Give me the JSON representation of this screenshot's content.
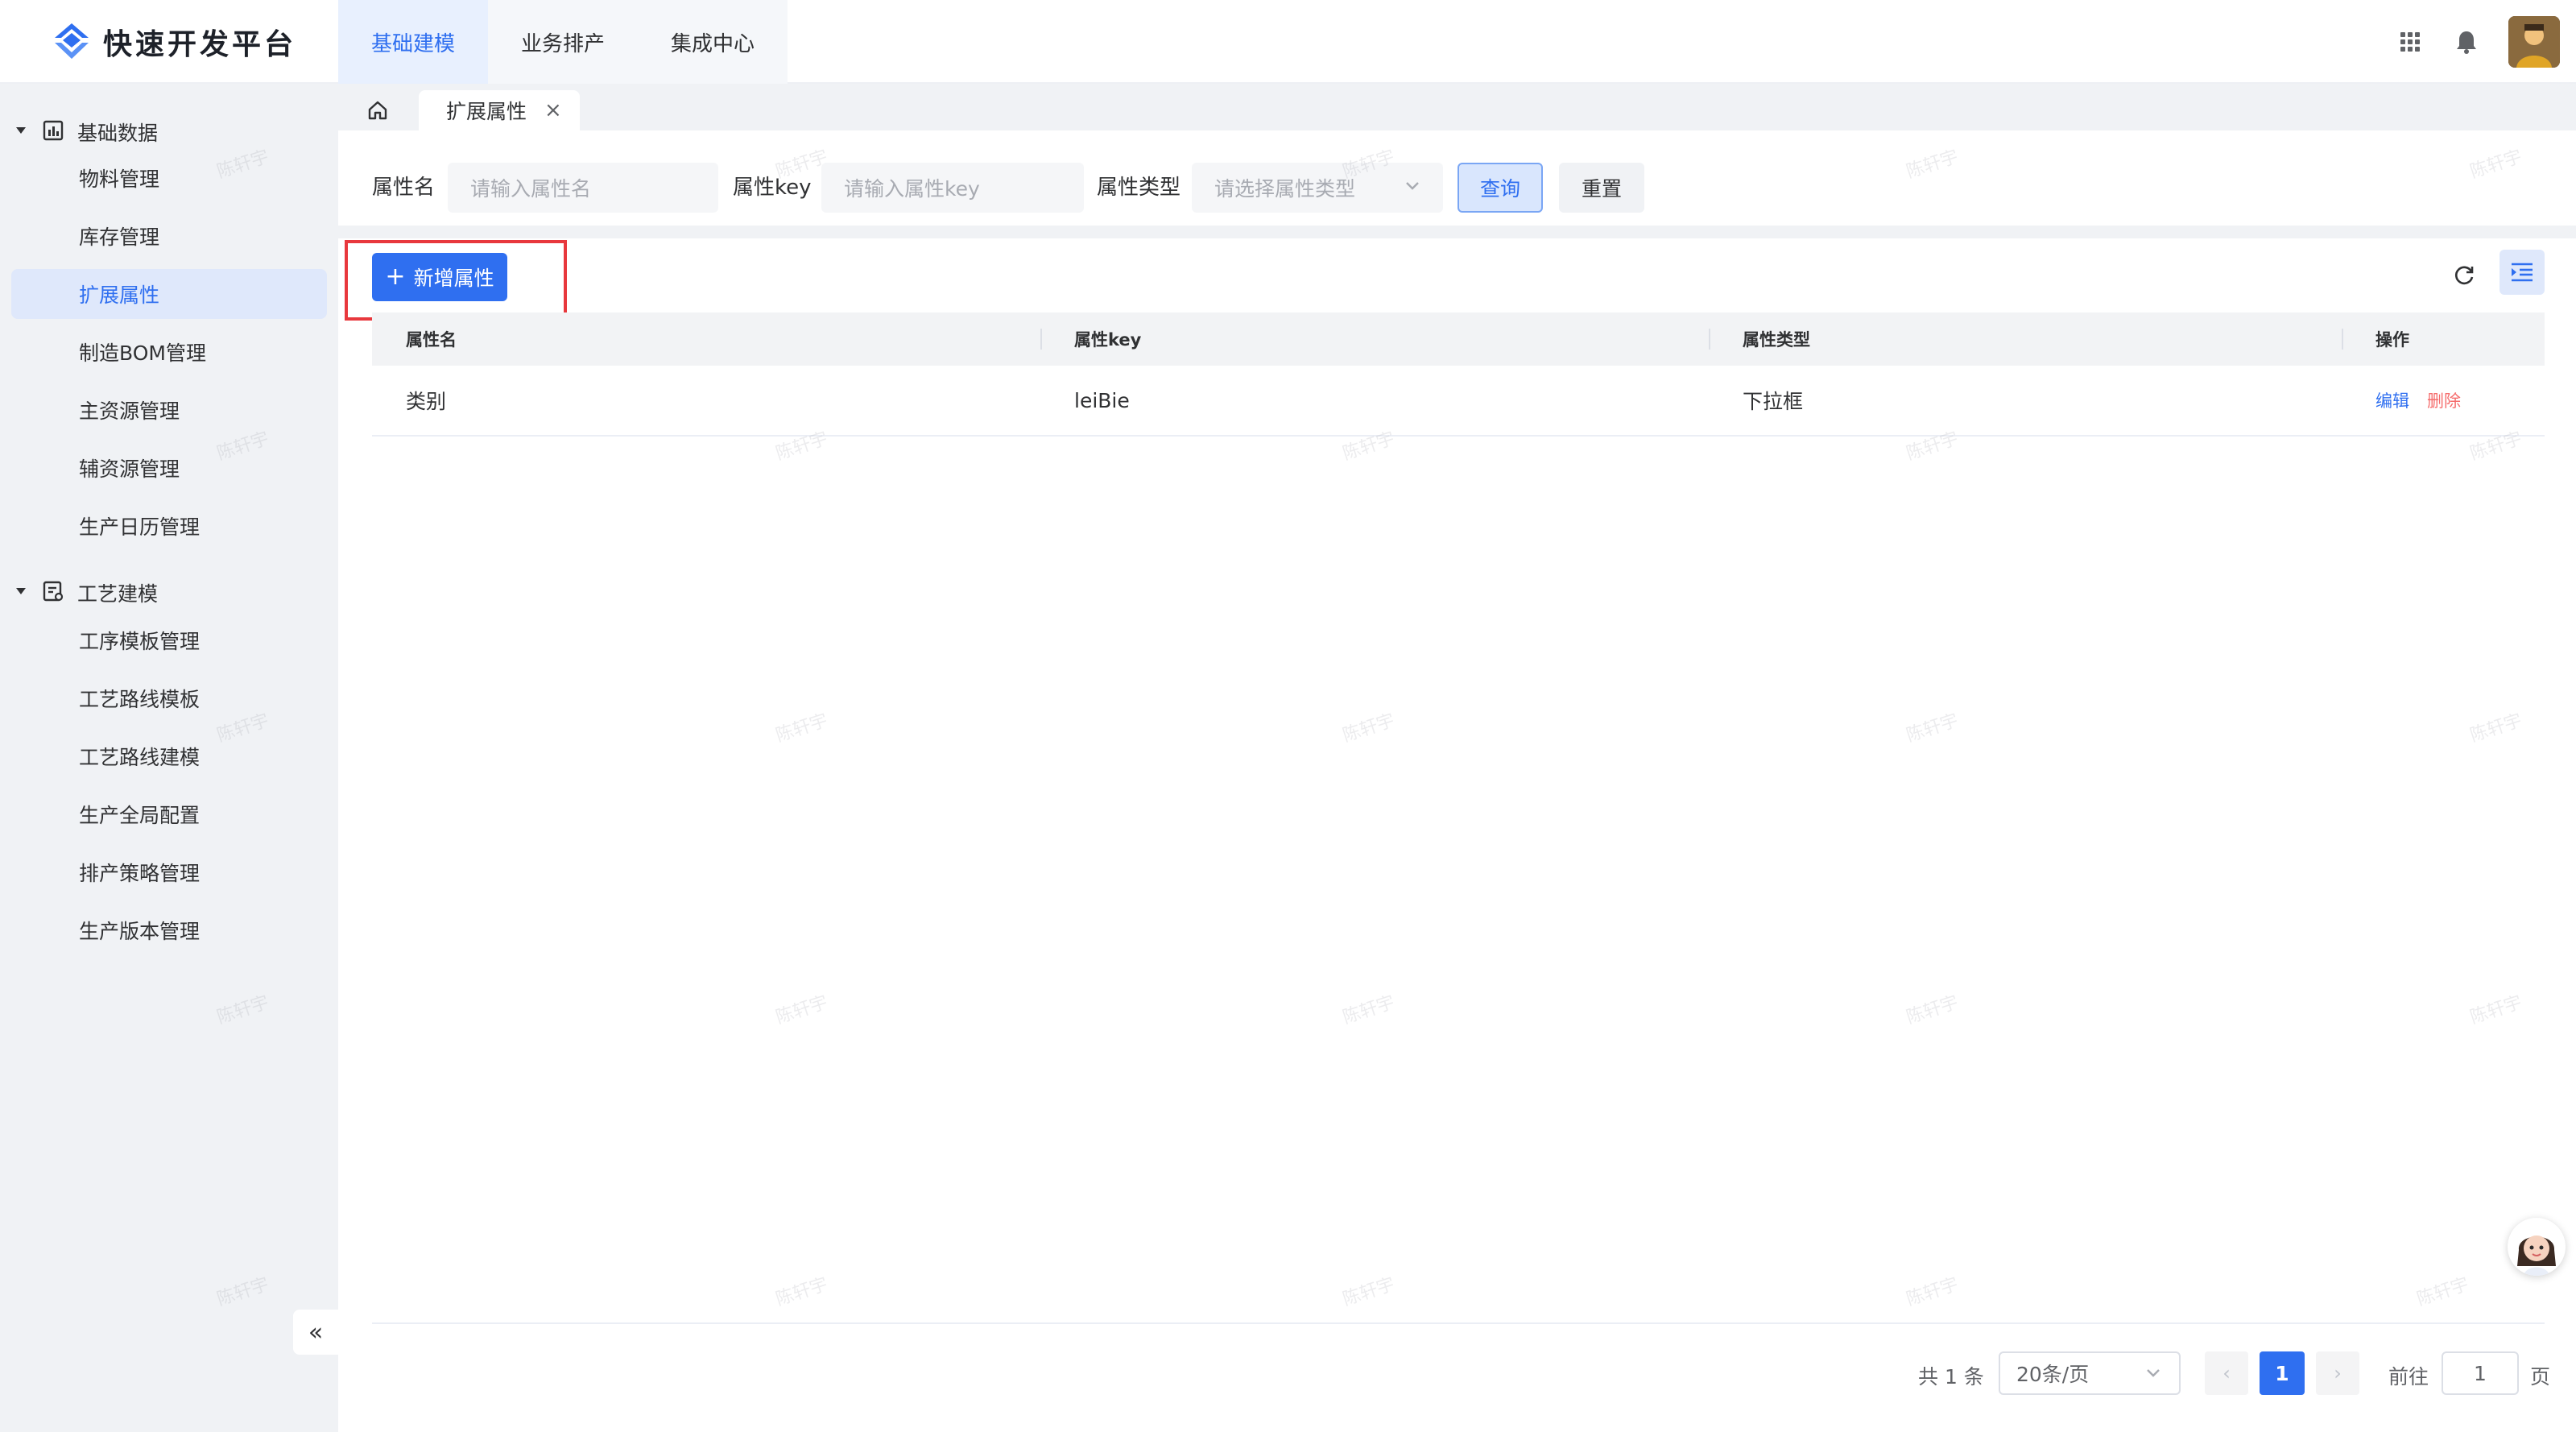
{
  "app": {
    "title": "快速开发平台"
  },
  "top_nav": {
    "items": [
      {
        "label": "基础建模"
      },
      {
        "label": "业务排产"
      },
      {
        "label": "集成中心"
      }
    ]
  },
  "sidebar": {
    "groups": [
      {
        "label": "基础数据",
        "items": [
          "物料管理",
          "库存管理",
          "扩展属性",
          "制造BOM管理",
          "主资源管理",
          "辅资源管理",
          "生产日历管理"
        ]
      },
      {
        "label": "工艺建模",
        "items": [
          "工序模板管理",
          "工艺路线模板",
          "工艺路线建模",
          "生产全局配置",
          "排产策略管理",
          "生产版本管理"
        ]
      }
    ],
    "active_item": "扩展属性",
    "collapse_label": "«"
  },
  "tabs": {
    "current": "扩展属性",
    "close": "×"
  },
  "search": {
    "name_label": "属性名",
    "name_placeholder": "请输入属性名",
    "key_label": "属性key",
    "key_placeholder": "请输入属性key",
    "type_label": "属性类型",
    "type_placeholder": "请选择属性类型",
    "query_label": "查询",
    "reset_label": "重置"
  },
  "toolbar": {
    "add_label": "新增属性",
    "add_icon": "+"
  },
  "table": {
    "columns": [
      "属性名",
      "属性key",
      "属性类型",
      "操作"
    ],
    "rows": [
      {
        "name": "类别",
        "key": "leiBie",
        "type": "下拉框",
        "edit": "编辑",
        "delete": "删除"
      }
    ]
  },
  "pagination": {
    "total": "共 1 条",
    "page_size": "20条/页",
    "prev": "‹",
    "next": "›",
    "current_page": "1",
    "goto_label": "前往",
    "goto_value": "1",
    "goto_unit": "页"
  },
  "watermark": "陈轩宇",
  "colors": {
    "primary": "#2f6ff0",
    "danger": "#f56c6c",
    "highlight": "#e8383d"
  }
}
